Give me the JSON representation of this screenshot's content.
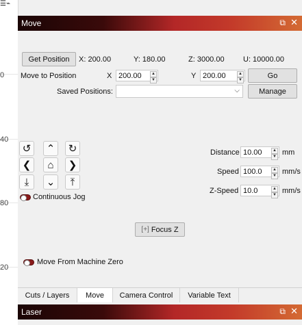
{
  "ruler": {
    "ticks": [
      "0",
      "40",
      "80",
      "20"
    ]
  },
  "move_panel": {
    "title": "Move",
    "get_position_label": "Get Position",
    "pos_x": "X: 200.00",
    "pos_y": "Y: 180.00",
    "pos_z": "Z: 3000.00",
    "pos_u": "U: 10000.00",
    "move_to_label": "Move to Position",
    "x_label": "X",
    "x_value": "200.00",
    "y_label": "Y",
    "y_value": "200.00",
    "go_label": "Go",
    "saved_positions_label": "Saved Positions:",
    "saved_positions_value": "",
    "manage_label": "Manage",
    "continuous_jog_label": "Continuous Jog",
    "distance_label": "Distance",
    "distance_value": "10.00",
    "distance_unit": "mm",
    "speed_label": "Speed",
    "speed_value": "100.0",
    "speed_unit": "mm/s",
    "zspeed_label": "Z-Speed",
    "zspeed_value": "10.0",
    "zspeed_unit": "mm/s",
    "focus_z_label": "Focus Z",
    "move_from_zero_label": "Move From Machine Zero"
  },
  "tabs": [
    "Cuts / Layers",
    "Move",
    "Camera Control",
    "Variable Text"
  ],
  "laser_panel": {
    "title": "Laser"
  }
}
